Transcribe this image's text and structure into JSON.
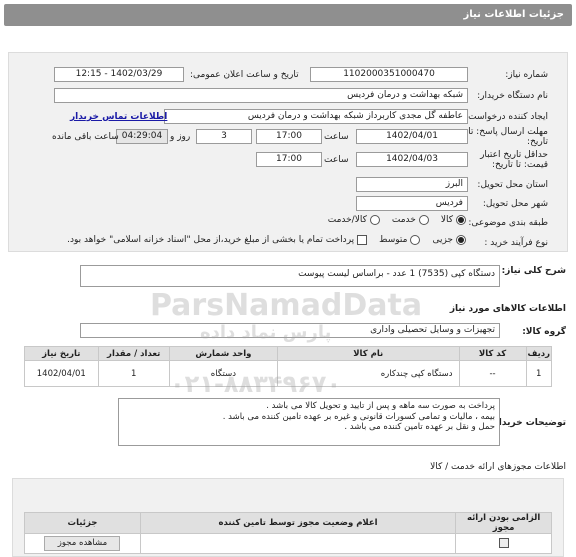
{
  "title": "جزئیات اطلاعات نیاز",
  "need_number": {
    "label": "شماره نیاز:",
    "value": "1102000351000470"
  },
  "announce_date": {
    "label": "تاریخ و ساعت اعلان عمومی:",
    "value": "1402/03/29 - 12:15"
  },
  "buyer_org": {
    "label": "نام دستگاه خریدار:",
    "value": "شبکه بهداشت و درمان فردیس"
  },
  "requester": {
    "label": "ایجاد کننده درخواست:",
    "value": "عاطفه گل مجدی کاربرداز شبکه بهداشت و درمان فردیس",
    "contact_link": "اطلاعات تماس خریدار"
  },
  "reply_deadline": {
    "label": "مهلت ارسال پاسخ: تا تاریخ:",
    "date": "1402/04/01",
    "time_label": "ساعت",
    "time": "17:00",
    "days": "3",
    "days_label": "روز و",
    "remaining": "04:29:04",
    "remaining_label": "ساعت باقی مانده"
  },
  "price_validity": {
    "label": "حداقل تاریخ اعتبار قیمت: تا تاریخ:",
    "date": "1402/04/03",
    "time_label": "ساعت",
    "time": "17:00"
  },
  "province": {
    "label": "استان محل تحویل:",
    "value": "البرز"
  },
  "city": {
    "label": "شهر محل تحویل:",
    "value": "فردیس"
  },
  "category": {
    "label": "طبقه بندی موضوعی:",
    "options": [
      "کالا",
      "خدمت",
      "کالا/خدمت"
    ],
    "selected": 0
  },
  "process": {
    "label": "نوع فرآیند خرید :",
    "options": [
      "جزیی",
      "متوسط"
    ],
    "selected": 0,
    "payment_note": "پرداخت تمام یا بخشی از مبلغ خرید،از محل \"اسناد خزانه اسلامی\" خواهد بود."
  },
  "summary": {
    "label": "شرح کلی نیاز:",
    "value": "دستگاه کپی (7535)  1 عدد - براساس لیست پیوست"
  },
  "goods_section_title": "اطلاعات کالاهای مورد نیاز",
  "goods_group": {
    "label": "گروه کالا:",
    "value": "تجهیزات و وسایل تحصیلی واداری"
  },
  "goods_table": {
    "headers": [
      "ردیف",
      "کد کالا",
      "نام کالا",
      "واحد شمارش",
      "تعداد / مقدار",
      "تاریخ نیاز"
    ],
    "rows": [
      [
        "1",
        "--",
        "دستگاه کپی چندکاره",
        "دستگاه",
        "1",
        "1402/04/01"
      ]
    ]
  },
  "buyer_notes": {
    "label": "توضیحات خریدار:",
    "lines": [
      "پرداخت به صورت سه ماهه و پس از تایید و تحویل کالا می باشد .",
      "بیمه ، مالیات و تمامی کسورات قانونی و غیره بر عهده تامین کننده می باشد .",
      "حمل و نقل بر عهده تامین کننده می باشد ."
    ]
  },
  "attachments_section_title": "اطلاعات مجوزهای ارائه خدمت / کالا",
  "license_table": {
    "headers": [
      "الزامی بودن ارائه مجوز",
      "اعلام وضعیت مجوز توسط تامین کننده",
      "جزئیات"
    ],
    "view_button": "مشاهده مجوز"
  },
  "watermark": {
    "brand": "ParsNamadData",
    "sub": "پارس نماد داده",
    "phone": "۰۲۱-۸۸۳۴۹۶۷۰"
  }
}
